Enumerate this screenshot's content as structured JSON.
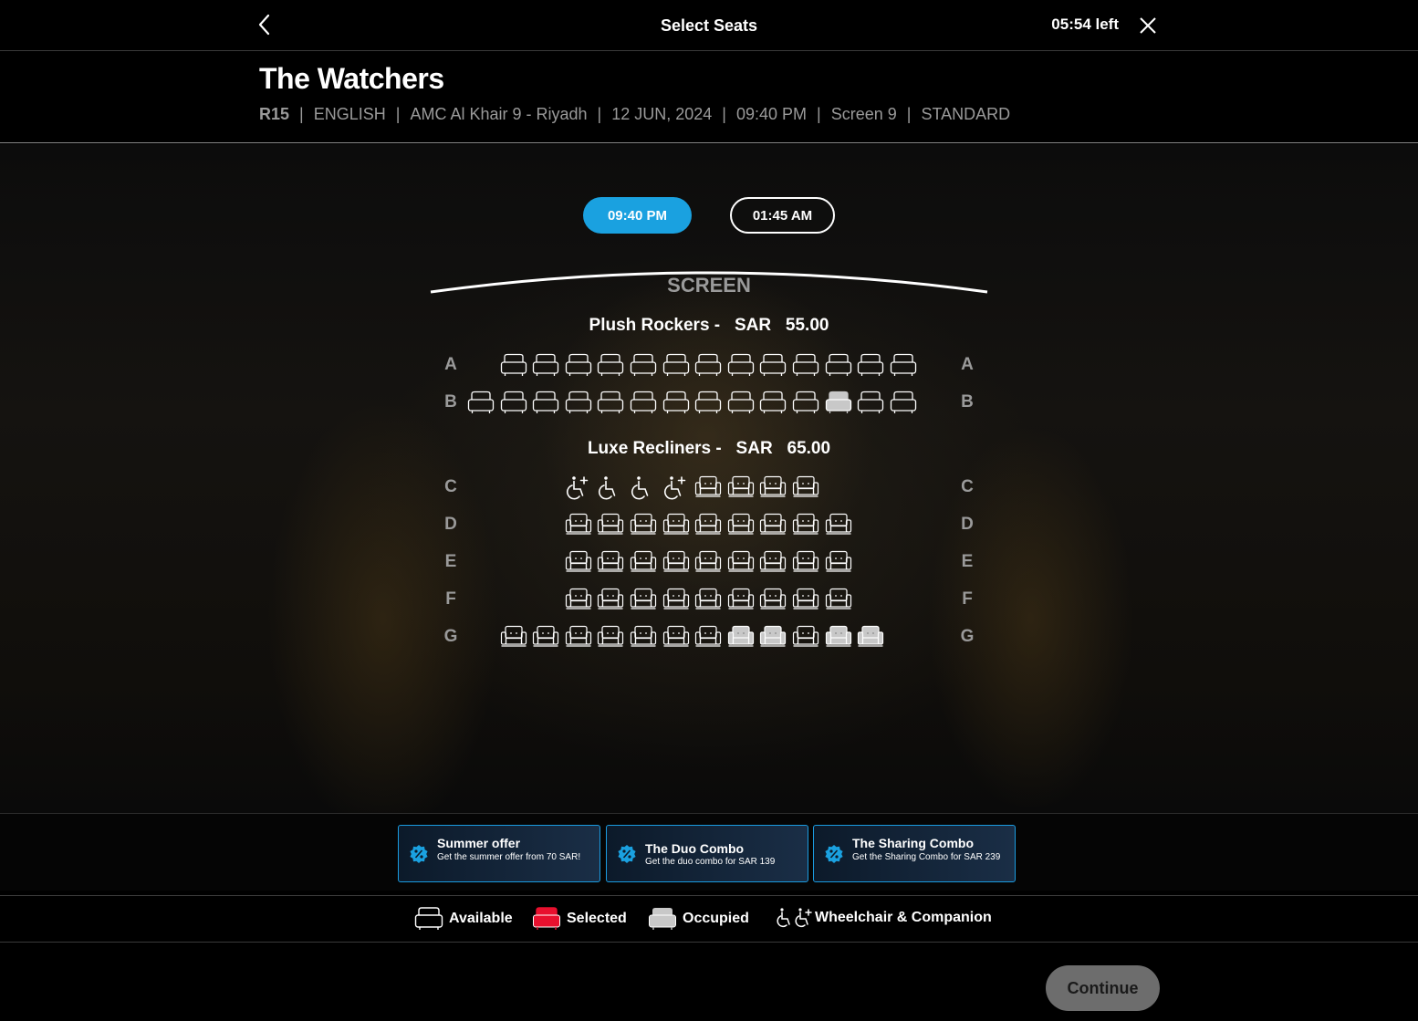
{
  "header": {
    "title": "Select Seats",
    "timer": "05:54 left"
  },
  "movie": {
    "title": "The Watchers",
    "rating": "R15",
    "language": "ENGLISH",
    "cinema": "AMC Al Khair 9 - Riyadh",
    "date": "12 JUN, 2024",
    "time": "09:40 PM",
    "screen": "Screen 9",
    "format": "STANDARD"
  },
  "showtimes": [
    {
      "label": "09:40 PM",
      "active": true
    },
    {
      "label": "01:45 AM",
      "active": false
    }
  ],
  "screen_label": "SCREEN",
  "sections": [
    {
      "label": "Plush Rockers -   SAR   55.00",
      "rows": [
        {
          "letter": "A",
          "seats": [
            "empty",
            "available",
            "available",
            "available",
            "available",
            "available",
            "available",
            "available",
            "available",
            "available",
            "available",
            "available",
            "available",
            "available"
          ]
        },
        {
          "letter": "B",
          "seats": [
            "available",
            "available",
            "available",
            "available",
            "available",
            "available",
            "available",
            "available",
            "available",
            "available",
            "available",
            "occupied",
            "available",
            "available"
          ]
        }
      ]
    },
    {
      "label": "Luxe Recliners -   SAR   65.00",
      "rows": [
        {
          "letter": "C",
          "seats": [
            "empty",
            "empty",
            "empty",
            "companion",
            "wheelchair",
            "wheelchair",
            "companion",
            "recliner",
            "recliner",
            "recliner",
            "recliner",
            "empty",
            "empty"
          ]
        },
        {
          "letter": "D",
          "seats": [
            "empty",
            "empty",
            "empty",
            "recliner",
            "recliner",
            "recliner",
            "recliner",
            "recliner",
            "recliner",
            "recliner",
            "recliner",
            "recliner",
            "empty"
          ]
        },
        {
          "letter": "E",
          "seats": [
            "empty",
            "empty",
            "empty",
            "recliner",
            "recliner",
            "recliner",
            "recliner",
            "recliner",
            "recliner",
            "recliner",
            "recliner",
            "recliner",
            "empty"
          ]
        },
        {
          "letter": "F",
          "seats": [
            "empty",
            "empty",
            "empty",
            "recliner",
            "recliner",
            "recliner",
            "recliner",
            "recliner",
            "recliner",
            "recliner",
            "recliner",
            "recliner",
            "empty"
          ]
        },
        {
          "letter": "G",
          "seats": [
            "empty",
            "recliner",
            "recliner",
            "recliner",
            "recliner",
            "recliner",
            "recliner",
            "recliner",
            "recliner-occupied",
            "recliner-occupied",
            "recliner",
            "recliner-occupied",
            "recliner-occupied"
          ]
        }
      ]
    }
  ],
  "offers": [
    {
      "title": "Summer offer",
      "description": "Get the summer offer from 70 SAR!"
    },
    {
      "title": "The Duo Combo",
      "description": "Get the duo combo for SAR 139"
    },
    {
      "title": "The Sharing Combo",
      "description": "Get the Sharing Combo for SAR 239"
    }
  ],
  "legend": {
    "available": "Available",
    "selected": "Selected",
    "occupied": "Occupied",
    "wheelchair": "Wheelchair & Companion"
  },
  "colors": {
    "accent": "#1aa1e0",
    "selected": "#e8102e",
    "occupied": "#c8c8c8",
    "seat_outline": "#ffffff"
  },
  "icons": [
    "chevron-left-icon",
    "close-icon",
    "percent-badge-icon",
    "seat-icon",
    "recliner-icon",
    "wheelchair-icon",
    "companion-icon"
  ],
  "continue_label": "Continue"
}
